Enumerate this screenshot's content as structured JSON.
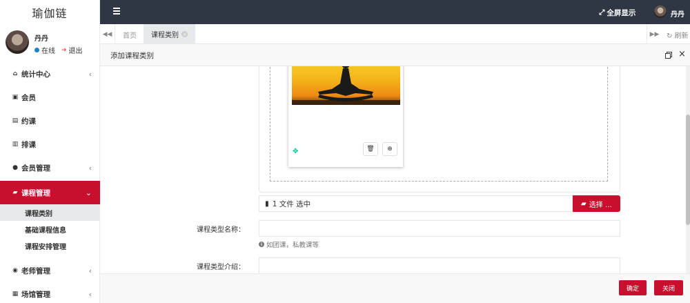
{
  "sidebar": {
    "brand": "瑜伽链",
    "profile": {
      "name": "丹丹",
      "status": "在线",
      "logout": "退出"
    },
    "items": [
      {
        "label": "统计中心",
        "icon": "home-icon",
        "has_arrow": true
      },
      {
        "label": "会员",
        "icon": "id-card-icon",
        "has_arrow": false
      },
      {
        "label": "约课",
        "icon": "contact-card-icon",
        "has_arrow": false
      },
      {
        "label": "排课",
        "icon": "schedule-card-icon",
        "has_arrow": false
      },
      {
        "label": "会员管理",
        "icon": "users-icon",
        "has_arrow": true
      },
      {
        "label": "课程管理",
        "icon": "book-icon",
        "has_arrow": true,
        "active": true
      },
      {
        "label": "老师管理",
        "icon": "user-circle-icon",
        "has_arrow": true
      },
      {
        "label": "场馆管理",
        "icon": "building-icon",
        "has_arrow": true
      }
    ],
    "subitems": [
      {
        "label": "课程类别",
        "active": true
      },
      {
        "label": "基础课程信息"
      },
      {
        "label": "课程安排管理"
      }
    ]
  },
  "topbar": {
    "fullscreen": "全屏显示",
    "user": "丹丹"
  },
  "tabs": {
    "home": "首页",
    "active": "课程类别",
    "refresh": "刷新"
  },
  "modal": {
    "title": "添加课程类别",
    "file_status": "1 文件 选中",
    "select_button": "选择 …",
    "fields": [
      {
        "label": "课程类型名称：",
        "value": ""
      },
      {
        "label": "课程类型介绍：",
        "value": ""
      }
    ],
    "help_text": "如团课，私教课等",
    "confirm": "确定",
    "close": "关闭"
  },
  "colors": {
    "accent": "#c8102e",
    "topbar": "#2f3644"
  }
}
